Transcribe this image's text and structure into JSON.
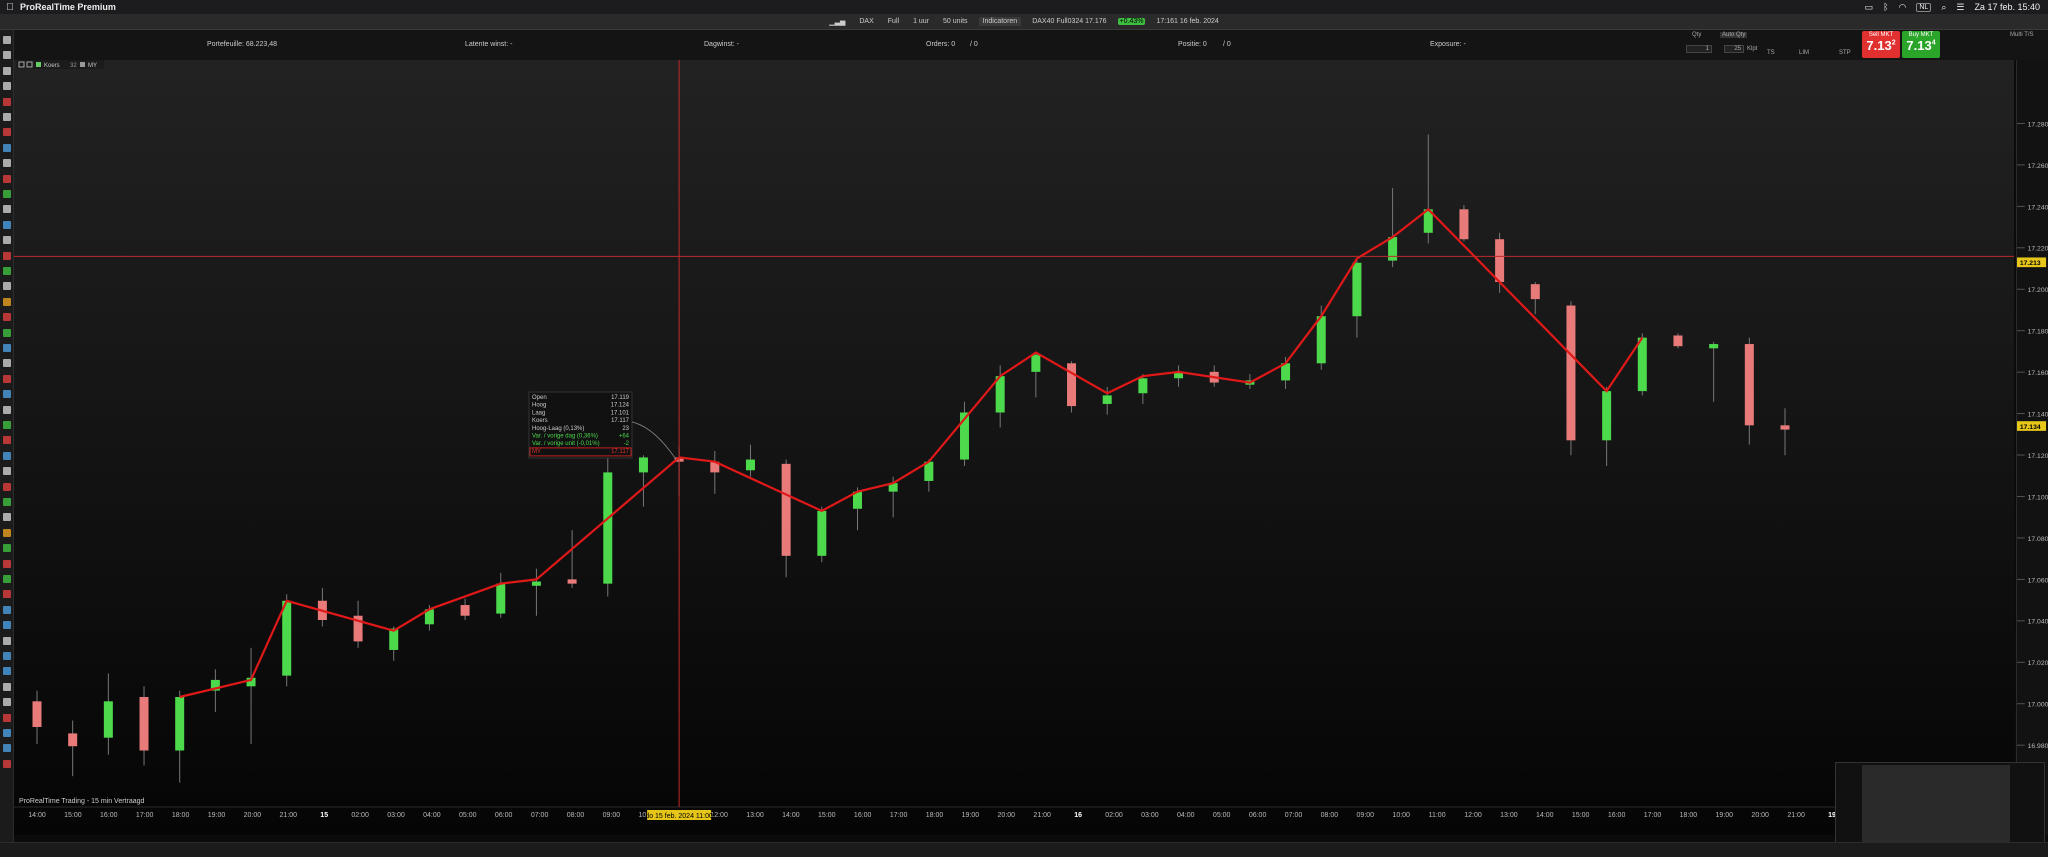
{
  "menubar": {
    "app_name": "ProRealTime Premium",
    "lang": "NL",
    "clock": "Za 17 feb. 15:40"
  },
  "toolbar": {
    "instrument": "DAX",
    "mode": "Full",
    "timeframe": "1 uur",
    "units": "50 units",
    "indicators": "Indicatoren",
    "ticker": "DAX40 Full0324 17.176",
    "change": "+0.43%",
    "time_info": "17:161 16 feb. 2024"
  },
  "infobar": {
    "portfolio": "Portefeuille: 68.223,48",
    "latent": "Latente winst: -",
    "daily": "Dagwinst: -",
    "orders": "Orders: 0",
    "orders_sep": "/ 0",
    "position": "Positie: 0",
    "position_sep": "/ 0",
    "exposure": "Exposure: -"
  },
  "orderpanel": {
    "qty_label": "Qty",
    "auto_qty": "Auto Qty",
    "qty_value": "1",
    "ticks": "25",
    "ticks_unit": "Klpt",
    "ts": "TS",
    "lim": "LIM",
    "stp": "STP",
    "sell_label": "Sell MKT",
    "sell_price": "7.13",
    "sell_sup": "2",
    "buy_label": "Buy MKT",
    "buy_price": "7.13",
    "buy_sup": "4",
    "multi": "Multi T/S"
  },
  "chart_legend": {
    "koers": "Koers",
    "koers_val": "32",
    "my": "MY"
  },
  "tooltip": {
    "rows": [
      {
        "label": "Open",
        "value": "17.119"
      },
      {
        "label": "Hoog",
        "value": "17.124"
      },
      {
        "label": "Laag",
        "value": "17.101"
      },
      {
        "label": "Koers",
        "value": "17.117"
      },
      {
        "label": "Hoog-Laag (0,13%)",
        "value": "23"
      },
      {
        "label": "Var. / vorige dag (0,36%)",
        "value": "+64"
      },
      {
        "label": "Var. / vorige unit (-0,01%)",
        "value": "-2"
      },
      {
        "label": "MY",
        "value": "17.117"
      }
    ]
  },
  "footer_label": "ProRealTime Trading - 15 min Vertraagd",
  "crosshair": {
    "date_label": "do 15 feb. 2024 11:00",
    "price_label": "17.213",
    "price": 17213,
    "current_price_label": "17.134",
    "current_price": 17134
  },
  "chart_data": {
    "type": "candlestick",
    "ylim": [
      16990,
      17290
    ],
    "y_ticks": [
      "17.280",
      "17.260",
      "17.240",
      "17.220",
      "17.200",
      "17.180",
      "17.160",
      "17.140",
      "17.120",
      "17.100",
      "17.080",
      "17.060",
      "17.040",
      "17.020",
      "17.000",
      "16.980"
    ],
    "y_tick_values": [
      17280,
      17260,
      17240,
      17220,
      17200,
      17180,
      17160,
      17140,
      17120,
      17100,
      17080,
      17060,
      17040,
      17020,
      17000,
      16980
    ],
    "x_labels": [
      "14:00",
      "15:00",
      "16:00",
      "17:00",
      "18:00",
      "19:00",
      "20:00",
      "21:00",
      "15",
      "02:00",
      "03:00",
      "04:00",
      "05:00",
      "06:00",
      "07:00",
      "08:00",
      "09:00",
      "10:00",
      "11:00",
      "12:00",
      "13:00",
      "14:00",
      "15:00",
      "16:00",
      "17:00",
      "18:00",
      "19:00",
      "20:00",
      "21:00",
      "16",
      "02:00",
      "03:00",
      "04:00",
      "05:00",
      "06:00",
      "07:00",
      "08:00",
      "09:00",
      "10:00",
      "11:00",
      "12:00",
      "13:00",
      "14:00",
      "15:00",
      "16:00",
      "17:00",
      "18:00",
      "19:00",
      "20:00",
      "21:00",
      "19"
    ],
    "candles": [
      {
        "o": 17005,
        "h": 17010,
        "l": 16985,
        "c": 16993
      },
      {
        "o": 16990,
        "h": 16996,
        "l": 16970,
        "c": 16984
      },
      {
        "o": 16988,
        "h": 17018,
        "l": 16980,
        "c": 17005
      },
      {
        "o": 17007,
        "h": 17012,
        "l": 16975,
        "c": 16982
      },
      {
        "o": 16982,
        "h": 17010,
        "l": 16967,
        "c": 17007
      },
      {
        "o": 17010,
        "h": 17020,
        "l": 17000,
        "c": 17015
      },
      {
        "o": 17012,
        "h": 17030,
        "l": 16985,
        "c": 17016
      },
      {
        "o": 17017,
        "h": 17055,
        "l": 17012,
        "c": 17052
      },
      {
        "o": 17052,
        "h": 17058,
        "l": 17040,
        "c": 17043
      },
      {
        "o": 17045,
        "h": 17052,
        "l": 17030,
        "c": 17033
      },
      {
        "o": 17029,
        "h": 17040,
        "l": 17024,
        "c": 17039
      },
      {
        "o": 17041,
        "h": 17050,
        "l": 17038,
        "c": 17048
      },
      {
        "o": 17050,
        "h": 17053,
        "l": 17043,
        "c": 17045
      },
      {
        "o": 17046,
        "h": 17065,
        "l": 17044,
        "c": 17060
      },
      {
        "o": 17059,
        "h": 17067,
        "l": 17045,
        "c": 17061
      },
      {
        "o": 17062,
        "h": 17085,
        "l": 17058,
        "c": 17060
      },
      {
        "o": 17060,
        "h": 17148,
        "l": 17054,
        "c": 17112
      },
      {
        "o": 17112,
        "h": 17120,
        "l": 17096,
        "c": 17119
      },
      {
        "o": 17119,
        "h": 17124,
        "l": 17101,
        "c": 17117
      },
      {
        "o": 17117,
        "h": 17122,
        "l": 17102,
        "c": 17112
      },
      {
        "o": 17113,
        "h": 17125,
        "l": 17110,
        "c": 17118
      },
      {
        "o": 17116,
        "h": 17118,
        "l": 17063,
        "c": 17073
      },
      {
        "o": 17073,
        "h": 17096,
        "l": 17070,
        "c": 17094
      },
      {
        "o": 17095,
        "h": 17105,
        "l": 17085,
        "c": 17103
      },
      {
        "o": 17103,
        "h": 17110,
        "l": 17091,
        "c": 17107
      },
      {
        "o": 17108,
        "h": 17118,
        "l": 17103,
        "c": 17117
      },
      {
        "o": 17118,
        "h": 17145,
        "l": 17115,
        "c": 17140
      },
      {
        "o": 17140,
        "h": 17162,
        "l": 17133,
        "c": 17157
      },
      {
        "o": 17159,
        "h": 17168,
        "l": 17147,
        "c": 17167
      },
      {
        "o": 17163,
        "h": 17164,
        "l": 17140,
        "c": 17143
      },
      {
        "o": 17144,
        "h": 17152,
        "l": 17139,
        "c": 17148
      },
      {
        "o": 17149,
        "h": 17158,
        "l": 17144,
        "c": 17156
      },
      {
        "o": 17156,
        "h": 17162,
        "l": 17152,
        "c": 17159
      },
      {
        "o": 17159,
        "h": 17162,
        "l": 17152,
        "c": 17154
      },
      {
        "o": 17153,
        "h": 17158,
        "l": 17151,
        "c": 17155
      },
      {
        "o": 17155,
        "h": 17166,
        "l": 17151,
        "c": 17163
      },
      {
        "o": 17163,
        "h": 17190,
        "l": 17160,
        "c": 17185
      },
      {
        "o": 17185,
        "h": 17212,
        "l": 17175,
        "c": 17210
      },
      {
        "o": 17211,
        "h": 17245,
        "l": 17208,
        "c": 17222
      },
      {
        "o": 17224,
        "h": 17270,
        "l": 17219,
        "c": 17235
      },
      {
        "o": 17235,
        "h": 17237,
        "l": 17220,
        "c": 17221
      },
      {
        "o": 17221,
        "h": 17224,
        "l": 17196,
        "c": 17201
      },
      {
        "o": 17200,
        "h": 17201,
        "l": 17186,
        "c": 17193
      },
      {
        "o": 17190,
        "h": 17192,
        "l": 17120,
        "c": 17127
      },
      {
        "o": 17127,
        "h": 17152,
        "l": 17115,
        "c": 17150
      },
      {
        "o": 17150,
        "h": 17177,
        "l": 17148,
        "c": 17175
      },
      {
        "o": 17176,
        "h": 17177,
        "l": 17170,
        "c": 17171
      },
      {
        "o": 17170,
        "h": 17173,
        "l": 17145,
        "c": 17172
      },
      {
        "o": 17172,
        "h": 17175,
        "l": 17125,
        "c": 17134
      },
      {
        "o": 17134,
        "h": 17142,
        "l": 17120,
        "c": 17132
      }
    ],
    "my_line": [
      17005,
      17012,
      17019,
      17052,
      17060,
      17073,
      17099,
      17111,
      17119,
      17168,
      17152,
      17158,
      17160,
      17155,
      17160,
      17212,
      17235,
      17150,
      17177
    ]
  },
  "colors": {
    "up": "#4cd94c",
    "down": "#e87a7a",
    "line": "#e01818",
    "crosshair": "#c02a2a",
    "grid": "#1a1a1a",
    "axis_text": "#bbbbbb",
    "price_tag": "#e6c619"
  }
}
